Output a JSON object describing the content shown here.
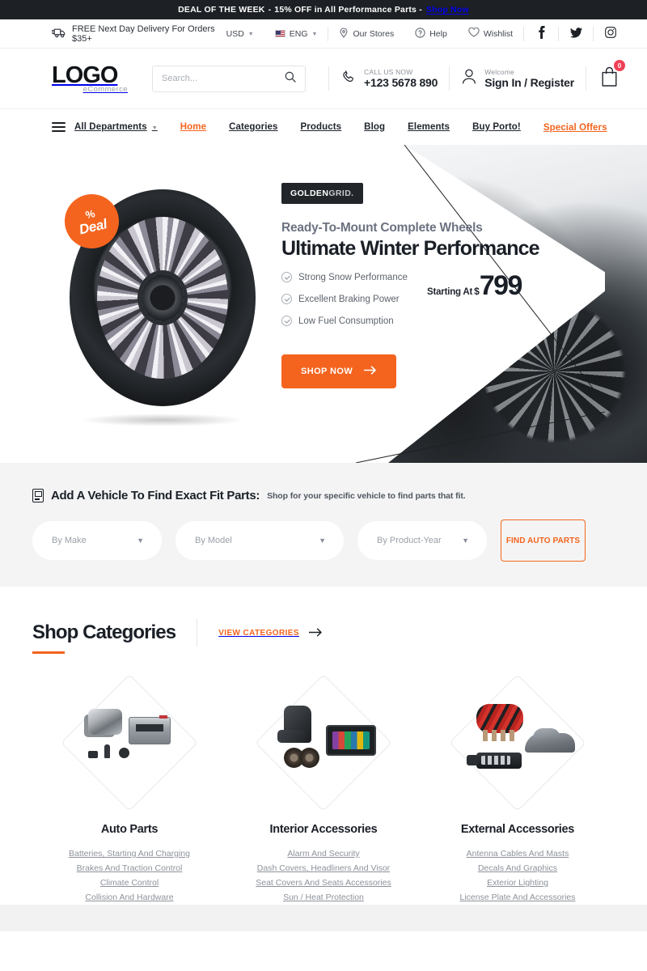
{
  "deal_bar": {
    "label": "DEAL OF THE WEEK",
    "dash": "-",
    "text": "15% OFF in All Performance Parts -",
    "cta": "Shop Now"
  },
  "utility_bar": {
    "delivery": "FREE Next Day Delivery For Orders $35+",
    "delivery_icon": "truck-icon",
    "currency": "USD",
    "language": "ENG",
    "stores": "Our Stores",
    "help": "Help",
    "wishlist": "Wishlist",
    "social": [
      {
        "name": "facebook-icon",
        "glyph": "f"
      },
      {
        "name": "twitter-icon",
        "glyph": "t"
      },
      {
        "name": "instagram-icon",
        "glyph": "i"
      }
    ]
  },
  "header": {
    "logo_main": "LOGO",
    "logo_sub": "eCommerce",
    "search_placeholder": "Search...",
    "search_value": "",
    "search_icon": "search-icon",
    "phone_label": "CALL US NOW",
    "phone_number": "+123 5678 890",
    "phone_icon": "phone-icon",
    "account_label": "Welcome",
    "account_action": "Sign In / Register",
    "account_icon": "user-icon",
    "cart_icon": "shopping-bag-icon",
    "cart_count": "0"
  },
  "nav": {
    "departments": "All Departments",
    "items": [
      {
        "label": "Home",
        "active": true
      },
      {
        "label": "Categories",
        "active": false
      },
      {
        "label": "Products",
        "active": false
      },
      {
        "label": "Blog",
        "active": false
      },
      {
        "label": "Elements",
        "active": false
      },
      {
        "label": "Buy Porto!",
        "active": false
      }
    ],
    "special": "Special Offers"
  },
  "hero": {
    "badge_pct": "%",
    "badge_word": "Deal",
    "brand_bold": "GOLDEN",
    "brand_light": "GRID.",
    "subtitle": "Ready-To-Mount Complete Wheels",
    "title": "Ultimate Winter Performance",
    "features": [
      "Strong Snow Performance",
      "Excellent Braking Power",
      "Low Fuel Consumption"
    ],
    "price_label": "Starting At",
    "price_currency": "$",
    "price_value": "799",
    "cta": "SHOP NOW",
    "cta_arrow": "arrow-right-icon"
  },
  "finder": {
    "icon": "vehicle-card-icon",
    "title": "Add A Vehicle To Find Exact Fit Parts:",
    "note": "Shop for your specific vehicle to find parts that fit.",
    "make_placeholder": "By Make",
    "model_placeholder": "By Model",
    "year_placeholder": "By Product-Year",
    "button": "FIND AUTO PARTS"
  },
  "categories": {
    "title": "Shop Categories",
    "view_all": "VIEW CATEGORIES",
    "view_all_arrow": "arrow-right-icon",
    "items": [
      {
        "name": "Auto Parts",
        "links": [
          "Batteries, Starting And Charging",
          "Brakes And Traction Control",
          "Climate Control",
          "Collision And Hardware"
        ]
      },
      {
        "name": "Interior Accessories",
        "links": [
          "Alarm And Security",
          "Dash Covers, Headliners And Visor",
          "Seat Covers And Seats Accessories",
          "Sun / Heat Protection"
        ]
      },
      {
        "name": "External Accessories",
        "links": [
          "Antenna Cables And Masts",
          "Decals And Graphics",
          "Exterior Lighting",
          "License Plate And Accessories"
        ]
      }
    ]
  },
  "colors": {
    "accent": "#f4641e",
    "dark": "#1d2024",
    "badge_red": "#ef4056",
    "section_gray": "#f4f4f4"
  }
}
